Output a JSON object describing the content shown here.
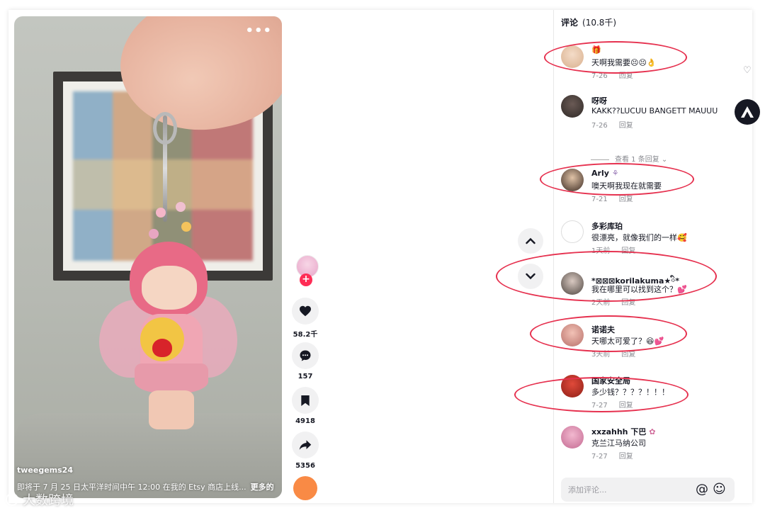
{
  "video": {
    "author": "tweegems24",
    "description": "即将于 7 月 25 日太平洋时间中午 12:00 在我的 Etsy 商店上线...",
    "more_label": "更多的",
    "menu_icon": "more-dots-icon"
  },
  "actions": {
    "likes": "58.2千",
    "comments": "157",
    "saves": "4918",
    "shares": "5356",
    "follow_label": "+"
  },
  "comments": {
    "title": "评论",
    "count": "(10.8千)",
    "items": [
      {
        "user": "",
        "text": "天啊我需要😣😣👌",
        "date": "7-26",
        "reply": "回复"
      },
      {
        "user": "呀呀",
        "text": "KAKK??LUCUU BANGETT MAUUU",
        "date": "7-26",
        "reply": "回复"
      },
      {
        "user": "Arly",
        "text": "噢天啊我现在就需要",
        "date": "7-21",
        "reply": "回复"
      },
      {
        "user": "多彩库珀",
        "text": "很漂亮，就像我们的一样🥰",
        "date": "1天前",
        "reply": "回复"
      },
      {
        "user": "*⊠⊠⊠korilakuma★ི*",
        "text": "我在哪里可以找到这个？💕",
        "date": "2天前",
        "reply": "回复"
      },
      {
        "user": "诺诺夫",
        "text": "天哪太可爱了？😆💕",
        "date": "3天前",
        "reply": "回复"
      },
      {
        "user": "国家安全局",
        "text": "多少钱？？？？！！！",
        "date": "7-27",
        "reply": "回复"
      },
      {
        "user": "xxzahhh 下巴",
        "text": "克兰江马纳公司",
        "date": "7-27",
        "reply": "回复"
      }
    ],
    "view_replies": "查看 1 条回复",
    "add_comment_placeholder": "添加评论...",
    "at_icon": "@",
    "emoji_icon": "☺"
  },
  "watermark": "大数跨境",
  "colors": {
    "accent": "#fe2c55",
    "annotation": "#e6314f",
    "music_disc": "#f98a45"
  }
}
